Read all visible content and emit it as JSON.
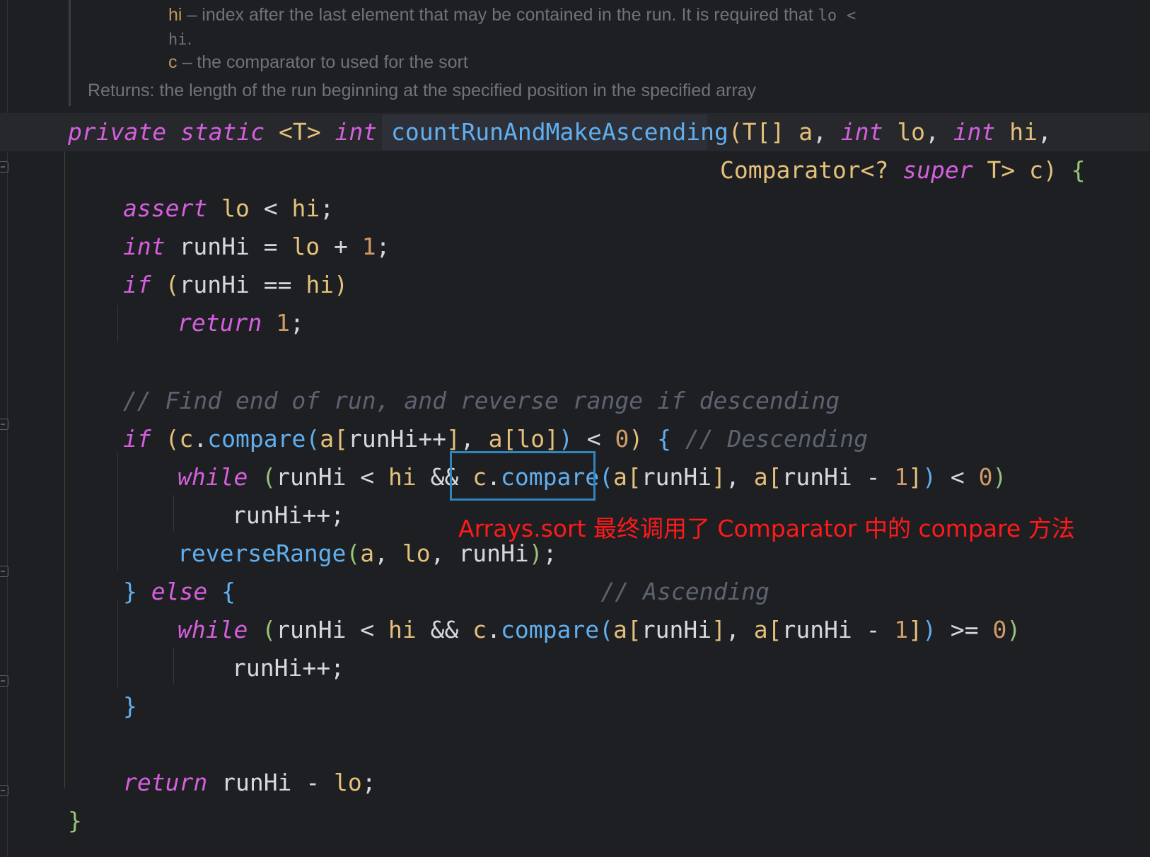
{
  "doc": {
    "hi_param": "hi",
    "hi_desc": " – index after the last element that may be contained in the run. It is required that ",
    "hi_code1": "lo",
    "hi_code2": "<",
    "hi_code3": "hi",
    "hi_end": ".",
    "c_param": "c",
    "c_desc": " – the comparator to used for the sort",
    "returns": "Returns: the length of the run beginning at the specified position in the specified array"
  },
  "code": {
    "sig": {
      "k1": "private",
      "k2": "static",
      "generic": "<T>",
      "k3": "int",
      "method": "countRunAndMakeAscending",
      "p_open": "(",
      "t_arr": "T[]",
      "a": "a",
      "c1": ",",
      "int1": "int",
      "lo": "lo",
      "c2": ",",
      "int2": "int",
      "hi": "hi",
      "c3": ","
    },
    "sig2": {
      "comparator": "Comparator<?",
      "super": "super",
      "rest": "T>",
      "c": "c",
      "close": ")",
      "brace": "{"
    },
    "l_assert": {
      "kw": "assert",
      "lo": "lo",
      "op": " < ",
      "hi": "hi",
      "semi": ";"
    },
    "l_int": {
      "kw": "int",
      "rest": " runHi = ",
      "lo": "lo",
      "plus": " + ",
      "one": "1",
      "semi": ";"
    },
    "l_if1": {
      "kw": "if",
      "open": "(",
      "mid": "runHi == ",
      "hi": "hi",
      "close": ")"
    },
    "l_ret1": {
      "kw": "return",
      "one": "1",
      "semi": ";"
    },
    "l_comment": "// Find end of run, and reverse range if descending",
    "l_if2": {
      "kw": "if",
      "open": "(",
      "c": "c",
      "dot": ".",
      "compare": "compare",
      "popen": "(",
      "a1": "a",
      "b1o": "[",
      "idx1": "runHi++",
      "b1c": "]",
      "comma": ", ",
      "a2": "a",
      "b2o": "[",
      "lo": "lo",
      "b2c": "]",
      "pclose": ")",
      "lt": " < ",
      "zero": "0",
      "close": ")",
      "brace": "{",
      "comment": "// Descending"
    },
    "l_while1": {
      "kw": "while",
      "open": "(",
      "mid": "runHi < ",
      "hi": "hi",
      "and": " && ",
      "c": "c",
      "dot": ".",
      "compare": "compare",
      "popen": "(",
      "a1": "a",
      "b1o": "[",
      "idx1": "runHi",
      "b1c": "]",
      "comma": ", ",
      "a2": "a",
      "b2o": "[",
      "idx2": "runHi - ",
      "one": "1",
      "b2c": "]",
      "pclose": ")",
      "lt": " < ",
      "zero": "0",
      "close": ")"
    },
    "l_inc1": "runHi++;",
    "l_reverse": {
      "fn": "reverseRange",
      "open": "(",
      "a": "a",
      "c1": ", ",
      "lo": "lo",
      "c2": ", ",
      "runhi": "runHi",
      "close": ")",
      "semi": ";"
    },
    "l_else": {
      "close": "}",
      "kw": "else",
      "brace": "{",
      "comment": "// Ascending"
    },
    "l_while2": {
      "kw": "while",
      "open": "(",
      "mid": "runHi < ",
      "hi": "hi",
      "and": " && ",
      "c": "c",
      "dot": ".",
      "compare": "compare",
      "popen": "(",
      "a1": "a",
      "b1o": "[",
      "idx1": "runHi",
      "b1c": "]",
      "comma": ", ",
      "a2": "a",
      "b2o": "[",
      "idx2": "runHi - ",
      "one": "1",
      "b2c": "]",
      "pclose": ")",
      "ge": " >= ",
      "zero": "0",
      "close": ")"
    },
    "l_inc2": "runHi++;",
    "l_close_else": "}",
    "l_ret2": {
      "kw": "return",
      "rest": " runHi - ",
      "lo": "lo",
      "semi": ";"
    },
    "l_close_method": "}"
  },
  "annotation": "Arrays.sort 最终调用了 Comparator 中的 compare 方法",
  "colors": {
    "background": "#1e1f22",
    "keyword": "#d55fde",
    "function": "#61afef",
    "param": "#e5c07b",
    "number": "#d19a66",
    "comment": "#5c6370",
    "highlight_box": "#2f86bd",
    "annotation": "#ff1a1a"
  }
}
